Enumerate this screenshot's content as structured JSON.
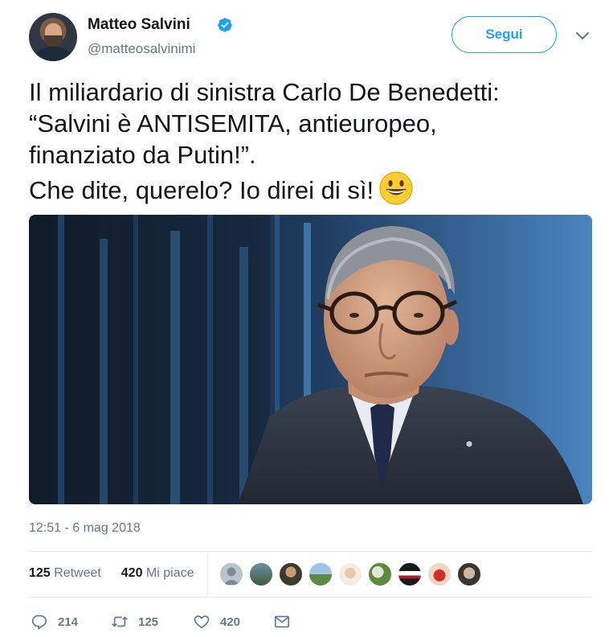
{
  "author": {
    "name": "Matteo Salvini",
    "handle": "@matteosalvinimi",
    "verified": true
  },
  "follow_button": {
    "label": "Segui"
  },
  "tweet": {
    "lines": [
      "Il miliardario di sinistra Carlo De Benedetti:",
      "“Salvini è ANTISEMITA, antieuropeo,",
      "finanziato da Putin!”.",
      "Che dite, querelo? Io direi di sì!"
    ],
    "emoji": "grinning-face-emoji"
  },
  "timestamp": "12:51 - 6 mag 2018",
  "stats": {
    "retweets_count": "125",
    "retweets_label": "Retweet",
    "likes_count": "420",
    "likes_label": "Mi piace"
  },
  "actions": {
    "replies": "214",
    "retweets": "125",
    "likes": "420"
  },
  "colors": {
    "brand": "#1da1f2",
    "text": "#14171a",
    "muted": "#657786",
    "divider": "#e6ecf0"
  },
  "icons": [
    "verified-badge-icon",
    "chevron-down-icon",
    "reply-icon",
    "retweet-icon",
    "like-heart-icon",
    "direct-message-icon"
  ]
}
